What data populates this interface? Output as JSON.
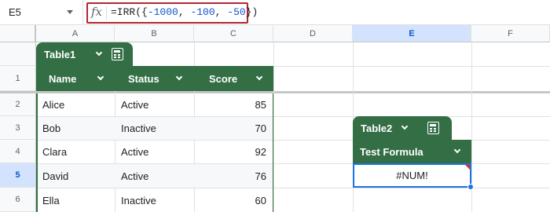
{
  "formula_bar": {
    "cell_ref": "E5",
    "fx_symbol": "fx",
    "formula_tokens": [
      "=IRR({",
      "-1000",
      ", ",
      "-100",
      ", ",
      "-50",
      "})"
    ]
  },
  "columns": [
    "A",
    "B",
    "C",
    "D",
    "E",
    "F"
  ],
  "selected_column": "E",
  "rows": [
    "1",
    "2",
    "3",
    "4",
    "5",
    "6"
  ],
  "selected_row": "5",
  "table1": {
    "name": "Table1",
    "headers": [
      "Name",
      "Status",
      "Score"
    ],
    "records": [
      {
        "name": "Alice",
        "status": "Active",
        "score": "85"
      },
      {
        "name": "Bob",
        "status": "Inactive",
        "score": "70"
      },
      {
        "name": "Clara",
        "status": "Active",
        "score": "92"
      },
      {
        "name": "David",
        "status": "Active",
        "score": "76"
      },
      {
        "name": "Ella",
        "status": "Inactive",
        "score": "60"
      }
    ]
  },
  "table2": {
    "name": "Table2",
    "header": "Test Formula",
    "value": "#NUM!"
  },
  "colors": {
    "table_green": "#336e45",
    "selection_blue": "#1a73e8",
    "highlight_red": "#b3262e",
    "number_blue": "#1155cc"
  },
  "icons": [
    "dropdown-arrow-icon",
    "fx-icon",
    "chevron-down-icon",
    "calculator-icon",
    "error-triangle-icon"
  ]
}
